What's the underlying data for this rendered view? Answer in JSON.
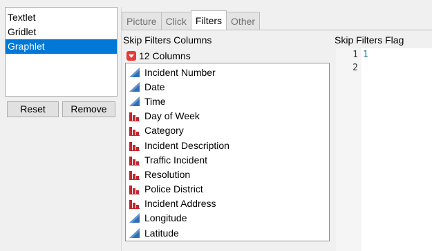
{
  "left_list": {
    "items": [
      {
        "label": "Textlet",
        "selected": false
      },
      {
        "label": "Gridlet",
        "selected": false
      },
      {
        "label": "Graphlet",
        "selected": true
      }
    ]
  },
  "buttons": {
    "reset": "Reset",
    "remove": "Remove"
  },
  "tabs": [
    {
      "label": "Picture",
      "active": false
    },
    {
      "label": "Click",
      "active": false
    },
    {
      "label": "Filters",
      "active": true
    },
    {
      "label": "Other",
      "active": false
    }
  ],
  "columns_panel": {
    "title": "Skip Filters Columns",
    "count_label": "12 Columns",
    "columns": [
      {
        "label": "Incident Number",
        "type": "continuous-icon"
      },
      {
        "label": "Date",
        "type": "continuous-icon"
      },
      {
        "label": "Time",
        "type": "continuous-icon"
      },
      {
        "label": "Day of Week",
        "type": "nominal-icon"
      },
      {
        "label": "Category",
        "type": "nominal-icon"
      },
      {
        "label": "Incident Description",
        "type": "nominal-icon"
      },
      {
        "label": "Traffic Incident",
        "type": "nominal-icon"
      },
      {
        "label": "Resolution",
        "type": "nominal-icon"
      },
      {
        "label": "Police District",
        "type": "nominal-icon"
      },
      {
        "label": "Incident Address",
        "type": "nominal-icon"
      },
      {
        "label": "Longitude",
        "type": "continuous-icon"
      },
      {
        "label": "Latitude",
        "type": "continuous-icon"
      }
    ]
  },
  "flag_panel": {
    "title": "Skip Filters Flag",
    "line_numbers": [
      "1",
      "2"
    ],
    "code_lines": [
      "1",
      ""
    ]
  },
  "colors": {
    "selection": "#0078d7",
    "continuous_icon": "#2f6fb8",
    "nominal_icon": "#c1272d",
    "code_text": "#1a7a8c"
  }
}
